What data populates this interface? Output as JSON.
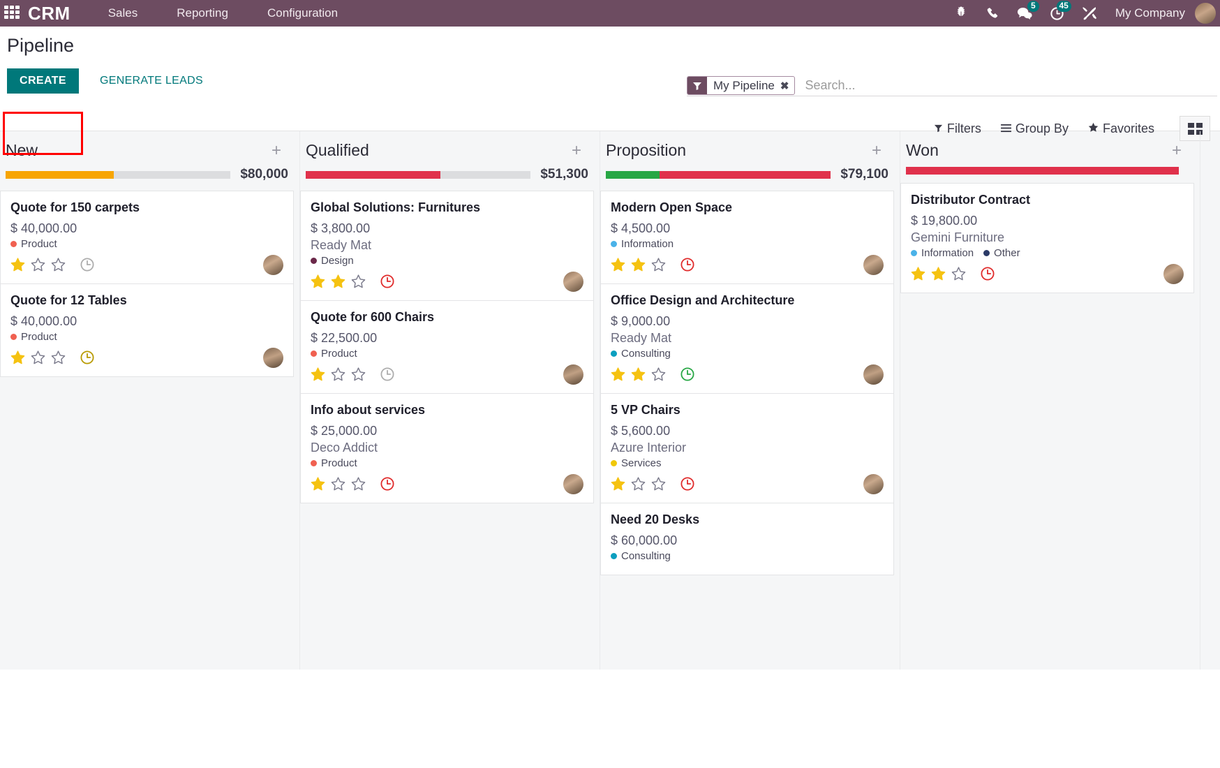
{
  "navbar": {
    "apps_icon": "apps-grid-icon",
    "brand": "CRM",
    "menus": [
      "Sales",
      "Reporting",
      "Configuration"
    ],
    "icons": [
      {
        "name": "bug-icon",
        "badge": null
      },
      {
        "name": "phone-icon",
        "badge": null
      },
      {
        "name": "chat-icon",
        "badge": "5"
      },
      {
        "name": "activity-clock-icon",
        "badge": "45"
      },
      {
        "name": "tools-icon",
        "badge": null
      }
    ],
    "company": "My Company",
    "avatar": "user-avatar",
    "bg_color": "#6d4c61"
  },
  "control_panel": {
    "title": "Pipeline",
    "create_label": "CREATE",
    "generate_leads_label": "GENERATE LEADS",
    "create_color": "#00787a",
    "highlight_color": "#ff0000",
    "search": {
      "facet_icon": "filter-icon",
      "facet_label": "My Pipeline",
      "facet_remove": "✖",
      "placeholder": "Search...",
      "value": ""
    },
    "filters_label": "Filters",
    "group_by_label": "Group By",
    "favorites_label": "Favorites",
    "view_switcher": [
      "kanban-view-icon"
    ]
  },
  "kanban": {
    "columns": [
      {
        "name": "New",
        "add_icon": "plus-icon",
        "total": "$80,000",
        "progress": [
          {
            "color": "#f7a501",
            "pct": 48
          },
          {
            "color": "#dcdddf",
            "pct": 52
          }
        ],
        "cards": [
          {
            "title": "Quote for 150 carpets",
            "amount": "$ 40,000.00",
            "partner": "",
            "tags": [
              {
                "label": "Product",
                "color": "#f06050"
              }
            ],
            "stars": 1,
            "activity": {
              "name": "activity-clock-icon",
              "color": "#adadad"
            },
            "avatar": "user-avatar"
          },
          {
            "title": "Quote for 12 Tables",
            "amount": "$ 40,000.00",
            "partner": "",
            "tags": [
              {
                "label": "Product",
                "color": "#f06050"
              }
            ],
            "stars": 1,
            "activity": {
              "name": "activity-clock-icon",
              "color": "#b89a00"
            },
            "avatar": "user-avatar"
          }
        ]
      },
      {
        "name": "Qualified",
        "add_icon": "plus-icon",
        "total": "$51,300",
        "progress": [
          {
            "color": "#e0314b",
            "pct": 60
          },
          {
            "color": "#dcdddf",
            "pct": 40
          }
        ],
        "cards": [
          {
            "title": "Global Solutions: Furnitures",
            "amount": "$ 3,800.00",
            "partner": "Ready Mat",
            "tags": [
              {
                "label": "Design",
                "color": "#6b2849"
              }
            ],
            "stars": 2,
            "activity": {
              "name": "activity-clock-icon",
              "color": "#e02b2b"
            },
            "avatar": "user-avatar"
          },
          {
            "title": "Quote for 600 Chairs",
            "amount": "$ 22,500.00",
            "partner": "",
            "tags": [
              {
                "label": "Product",
                "color": "#f06050"
              }
            ],
            "stars": 1,
            "activity": {
              "name": "activity-clock-icon",
              "color": "#adadad"
            },
            "avatar": "user-avatar"
          },
          {
            "title": "Info about services",
            "amount": "$ 25,000.00",
            "partner": "Deco Addict",
            "tags": [
              {
                "label": "Product",
                "color": "#f06050"
              }
            ],
            "stars": 1,
            "activity": {
              "name": "activity-clock-icon",
              "color": "#e02b2b"
            },
            "avatar": "user-avatar"
          }
        ]
      },
      {
        "name": "Proposition",
        "add_icon": "plus-icon",
        "total": "$79,100",
        "progress": [
          {
            "color": "#28a745",
            "pct": 24
          },
          {
            "color": "#e0314b",
            "pct": 76
          }
        ],
        "cards": [
          {
            "title": "Modern Open Space",
            "amount": "$ 4,500.00",
            "partner": "",
            "tags": [
              {
                "label": "Information",
                "color": "#4ab2e8"
              }
            ],
            "stars": 2,
            "activity": {
              "name": "activity-clock-icon",
              "color": "#e02b2b"
            },
            "avatar": "user-avatar"
          },
          {
            "title": "Office Design and Architecture",
            "amount": "$ 9,000.00",
            "partner": "Ready Mat",
            "tags": [
              {
                "label": "Consulting",
                "color": "#0b9fbf"
              }
            ],
            "stars": 2,
            "activity": {
              "name": "activity-clock-icon",
              "color": "#28a745"
            },
            "avatar": "user-avatar"
          },
          {
            "title": "5 VP Chairs",
            "amount": "$ 5,600.00",
            "partner": "Azure Interior",
            "tags": [
              {
                "label": "Services",
                "color": "#f0c808"
              }
            ],
            "stars": 1,
            "activity": {
              "name": "activity-clock-icon",
              "color": "#e02b2b"
            },
            "avatar": "user-avatar"
          },
          {
            "title": "Need 20 Desks",
            "amount": "$ 60,000.00",
            "partner": "",
            "tags": [
              {
                "label": "Consulting",
                "color": "#0b9fbf"
              }
            ],
            "stars": 0,
            "activity": null,
            "avatar": ""
          }
        ]
      },
      {
        "name": "Won",
        "add_icon": "plus-icon",
        "total": "",
        "progress": [
          {
            "color": "#e0314b",
            "pct": 100
          }
        ],
        "cards": [
          {
            "title": "Distributor Contract",
            "amount": "$ 19,800.00",
            "partner": "Gemini Furniture",
            "tags": [
              {
                "label": "Information",
                "color": "#4ab2e8"
              },
              {
                "label": "Other",
                "color": "#2b3a67"
              }
            ],
            "stars": 2,
            "activity": {
              "name": "activity-clock-icon",
              "color": "#e02b2b"
            },
            "avatar": "user-avatar"
          }
        ]
      }
    ]
  }
}
